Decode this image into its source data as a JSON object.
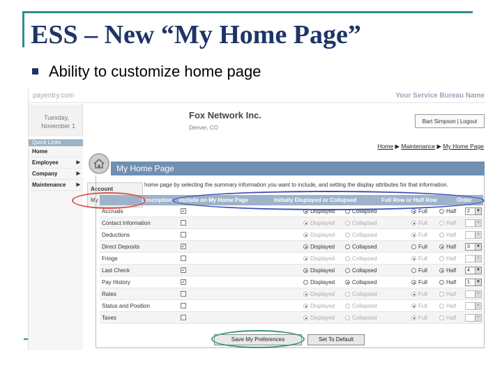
{
  "slide": {
    "title": "ESS – New “My Home Page”",
    "bullet": "Ability to customize home page"
  },
  "app": {
    "logo": "payentry.com",
    "bureau": "Your Service Bureau Name",
    "date_line1": "Tuesday,",
    "date_line2": "November 1",
    "company": "Fox Network Inc.",
    "location": "Denver, CO",
    "user": "Bart Simpson",
    "logout": "Logout"
  },
  "sidebar": {
    "header": "Quick Links",
    "items": [
      {
        "label": "Home",
        "arrow": ""
      },
      {
        "label": "Employee",
        "arrow": "▶"
      },
      {
        "label": "Company",
        "arrow": "▶"
      },
      {
        "label": "Maintenance",
        "arrow": "▶"
      }
    ],
    "submenu": [
      "Account",
      "My Home Page"
    ]
  },
  "breadcrumb": {
    "home": "Home",
    "sep": "▶",
    "maintenance": "Maintenance",
    "current": "My Home Page"
  },
  "panel": {
    "title": "My Home Page",
    "description": "home page by selecting the summary information you want to include, and setting the display attributes for that information."
  },
  "table": {
    "headers": [
      "Description",
      "Include on My Home Page",
      "Initially Displayed or Collapsed",
      "Full Row or Half Row",
      "Order"
    ],
    "radio_labels": {
      "displayed": "Displayed",
      "collapsed": "Collapsed",
      "full": "Full",
      "half": "Half"
    },
    "rows": [
      {
        "name": "Accruals",
        "include": true,
        "display": "Displayed",
        "width": "Full",
        "order": "2"
      },
      {
        "name": "Contact Information",
        "include": false,
        "display": "Displayed",
        "width": "Full",
        "order": ""
      },
      {
        "name": "Deductions",
        "include": false,
        "display": "Displayed",
        "width": "Full",
        "order": ""
      },
      {
        "name": "Direct Deposits",
        "include": true,
        "display": "Displayed",
        "width": "Half",
        "order": "3"
      },
      {
        "name": "Fringe",
        "include": false,
        "display": "Displayed",
        "width": "Full",
        "order": ""
      },
      {
        "name": "Last Check",
        "include": true,
        "display": "Displayed",
        "width": "Half",
        "order": "4"
      },
      {
        "name": "Pay History",
        "include": true,
        "display": "Collapsed",
        "width": "Full",
        "order": "1"
      },
      {
        "name": "Rates",
        "include": false,
        "display": "Displayed",
        "width": "Full",
        "order": ""
      },
      {
        "name": "Status and Position",
        "include": false,
        "display": "Displayed",
        "width": "Full",
        "order": ""
      },
      {
        "name": "Taxes",
        "include": false,
        "display": "Displayed",
        "width": "Full",
        "order": ""
      }
    ]
  },
  "buttons": {
    "save": "Save My Preferences",
    "default": "Set To Default"
  },
  "colors": {
    "title": "#1d3566",
    "accent_line": "#2a8f8f",
    "panel_title_bg": "#6f8fb3",
    "header_bg": "#9eb3c9",
    "highlight_red": "#d9534f",
    "highlight_blue": "#3b4fb8",
    "highlight_green": "#3a9a6a"
  }
}
